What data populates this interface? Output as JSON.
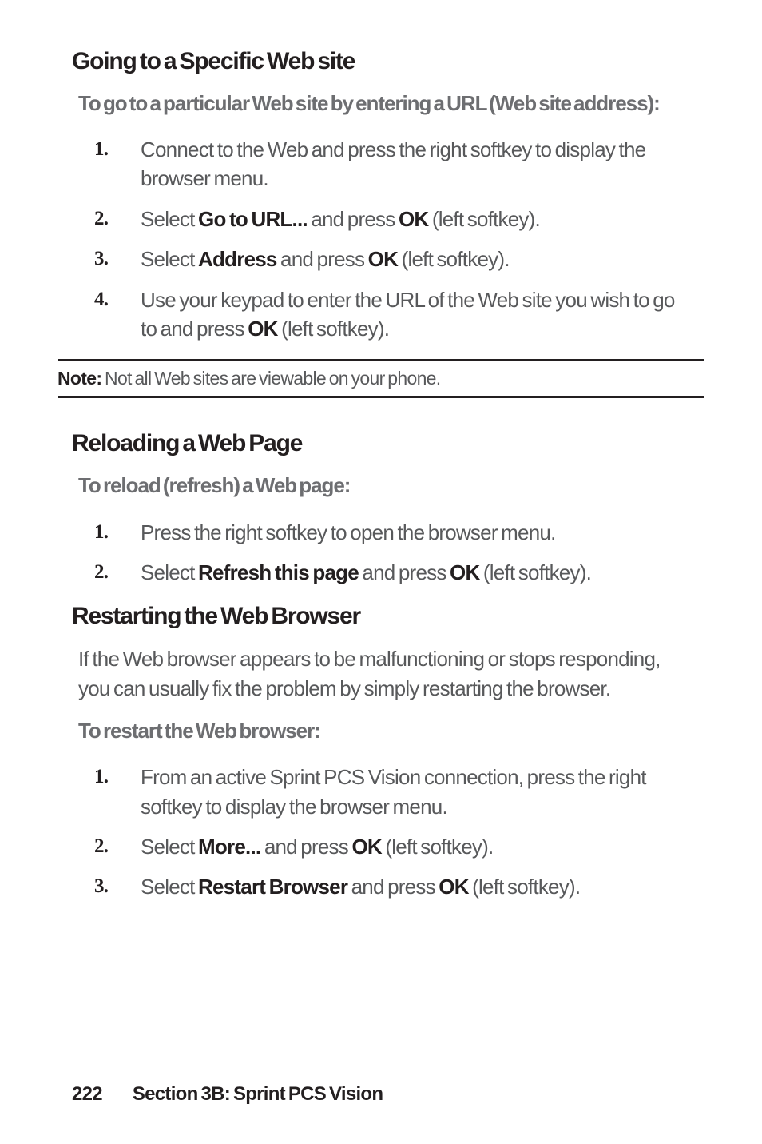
{
  "section1": {
    "heading": "Going to a Specific Web site",
    "intro": "To go to a particular Web site by entering a URL (Web site address):",
    "steps": [
      {
        "pre": "Connect to the Web and press the right softkey to display the browser menu.",
        "bold": "",
        "post": ""
      },
      {
        "pre": "Select ",
        "bold": "Go to URL...",
        "mid": " and press ",
        "bold2": "OK",
        "post": " (left softkey)."
      },
      {
        "pre": "Select ",
        "bold": "Address",
        "mid": " and press ",
        "bold2": "OK",
        "post": " (left softkey)."
      },
      {
        "pre": "Use your keypad to enter the URL of the Web site you wish to go to and press ",
        "bold": "OK",
        "post": " (left softkey)."
      }
    ]
  },
  "note": {
    "label": "Note:",
    "text": " Not all Web sites are viewable on your phone."
  },
  "section2": {
    "heading": "Reloading a Web Page",
    "intro": "To reload (refresh) a Web page:",
    "steps": [
      {
        "pre": "Press the right softkey to open the browser menu."
      },
      {
        "pre": "Select ",
        "bold": "Refresh this page",
        "mid": " and press ",
        "bold2": "OK",
        "post": " (left softkey)."
      }
    ]
  },
  "section3": {
    "heading": "Restarting the Web Browser",
    "body": "If the Web browser appears to be malfunctioning or stops responding, you can usually fix the problem by simply restarting the browser.",
    "intro": "To restart the Web browser:",
    "steps": [
      {
        "pre": "From an active Sprint PCS Vision connection, press the right softkey to display the browser menu."
      },
      {
        "pre": "Select ",
        "bold": "More...",
        "mid": " and press ",
        "bold2": "OK",
        "post": " (left softkey)."
      },
      {
        "pre": "Select ",
        "bold": "Restart Browser",
        "mid": " and press ",
        "bold2": "OK",
        "post": " (left softkey)."
      }
    ]
  },
  "footer": {
    "page": "222",
    "section": "Section 3B: Sprint PCS Vision"
  }
}
